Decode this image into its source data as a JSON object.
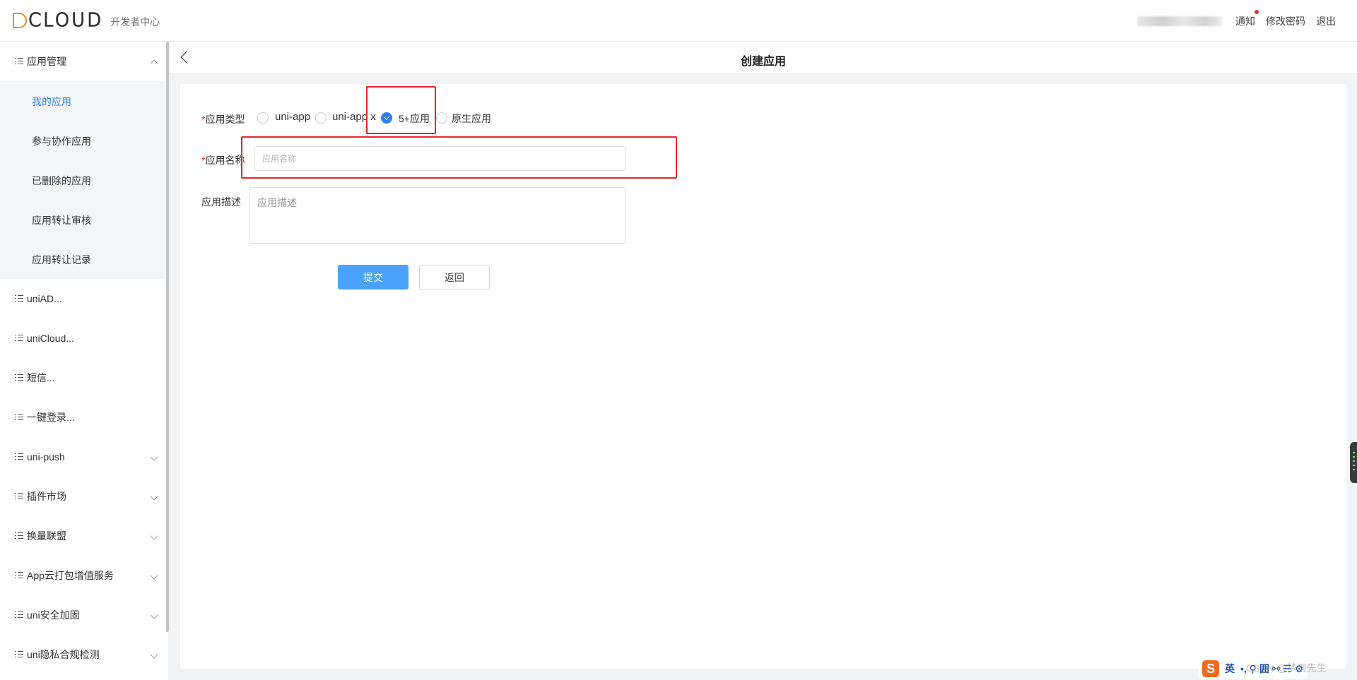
{
  "header": {
    "logo_text": "CLOUD",
    "logo_sub": "开发者中心",
    "notify": "通知",
    "change_password": "修改密码",
    "logout": "退出"
  },
  "sidebar": {
    "group_app": "应用管理",
    "sub_items": [
      "我的应用",
      "参与协作应用",
      "已删除的应用",
      "应用转让审核",
      "应用转让记录"
    ],
    "items": [
      "uniAD...",
      "uniCloud...",
      "短信...",
      "一键登录...",
      "uni-push",
      "插件市场",
      "换量联盟",
      "App云打包增值服务",
      "uni安全加固",
      "uni隐私合规检测"
    ]
  },
  "page": {
    "title": "创建应用"
  },
  "form": {
    "type_label": "应用类型",
    "required_mark": "*",
    "type_options": [
      "uni-app",
      "uni-app x",
      "5+应用",
      "原生应用"
    ],
    "selected_type": "5+应用",
    "name_label": "应用名称",
    "name_placeholder": "应用名称",
    "desc_label": "应用描述",
    "desc_placeholder": "应用描述",
    "submit": "提交",
    "back": "返回"
  },
  "ime": {
    "logo": "S",
    "mode": "英",
    "glyphs": "•, ⚲ 囲 ⚯ ☴ ⚙"
  },
  "watermark": "CSDN @梦雨先生",
  "colors": {
    "accent": "#2f7ff0",
    "submit_bg": "#4aa2fd",
    "highlight": "#e5262a",
    "logo_orange": "#f08a24"
  }
}
